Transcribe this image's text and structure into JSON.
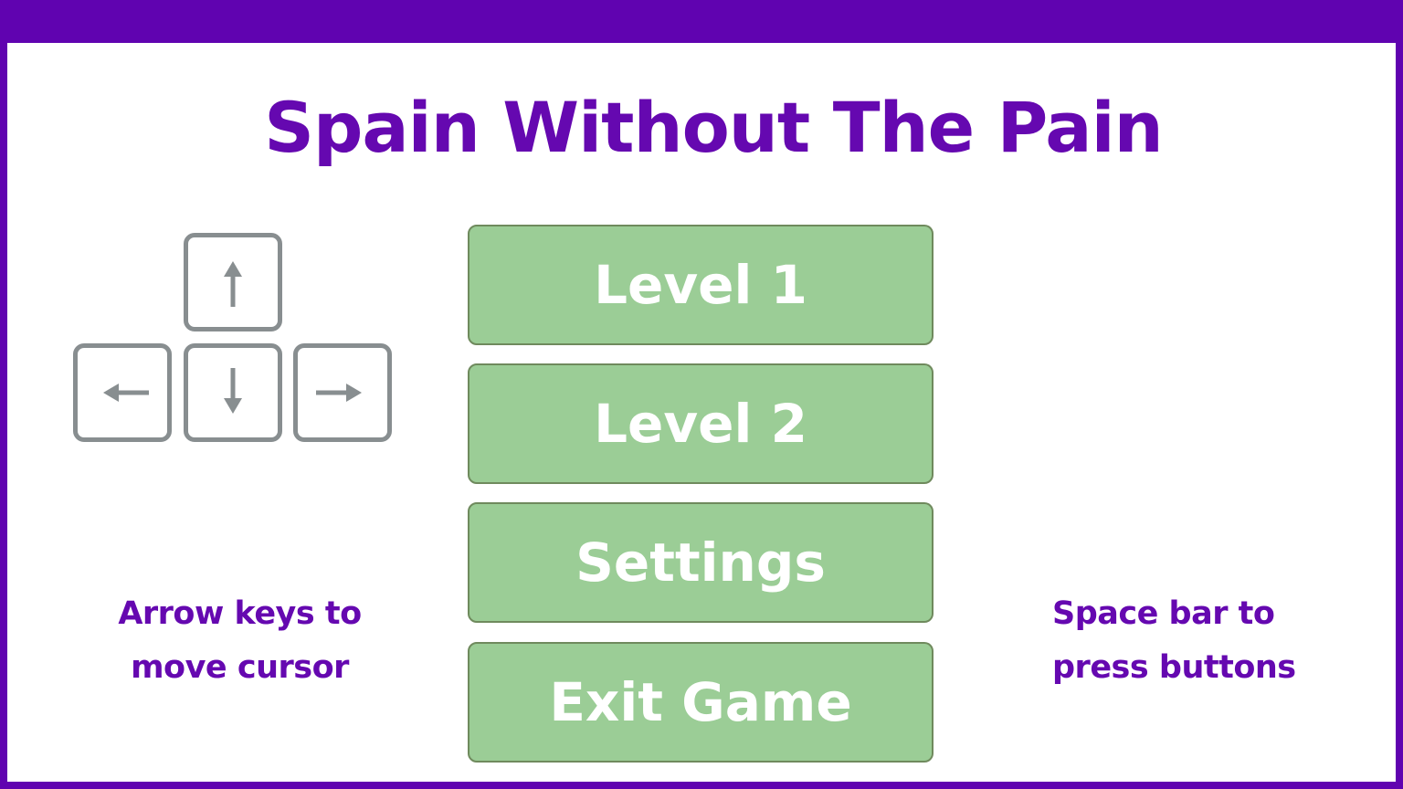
{
  "title": "Spain Without The Pain",
  "menu": {
    "buttons": [
      {
        "label": "Level 1"
      },
      {
        "label": "Level 2"
      },
      {
        "label": "Settings"
      },
      {
        "label": "Exit Game"
      }
    ]
  },
  "controls": {
    "arrow_keys": [
      "arrow-up-key",
      "arrow-left-key",
      "arrow-down-key",
      "arrow-right-key"
    ],
    "move_hint_line1": "Arrow keys to",
    "move_hint_line2": "move cursor",
    "press_hint_line1": "Space bar to",
    "press_hint_line2": "press buttons"
  },
  "colors": {
    "frame": "#6003b0",
    "title": "#6508b0",
    "button_fill": "#9bcd96",
    "button_text": "#ffffff",
    "key_outline": "#888e90"
  }
}
